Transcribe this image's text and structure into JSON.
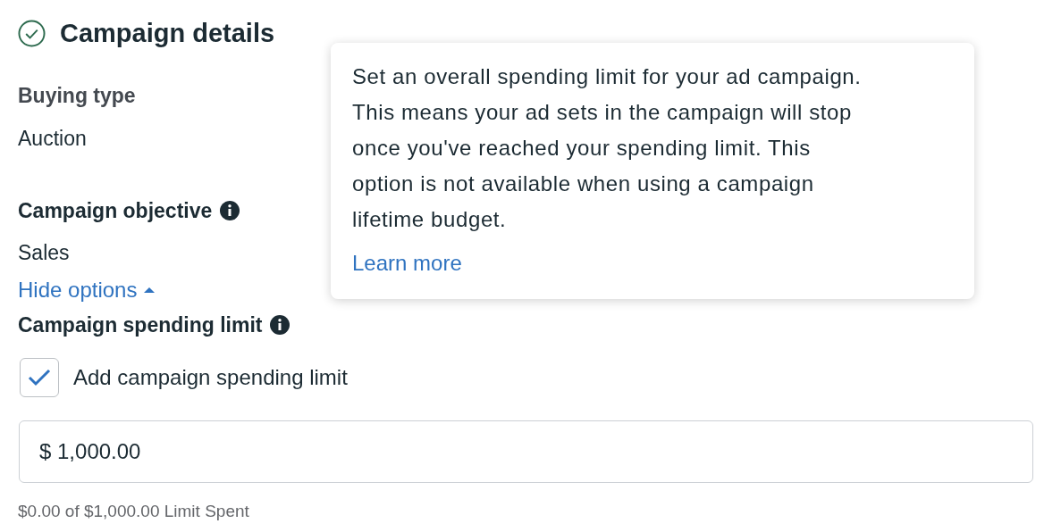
{
  "section": {
    "title": "Campaign details",
    "completed": true
  },
  "fields": [
    {
      "label": "Buying type",
      "info": false,
      "value": "Auction"
    },
    {
      "label": "Campaign objective",
      "info": true,
      "value": "Sales"
    }
  ],
  "toggle_link": {
    "label": "Hide options",
    "expanded": true
  },
  "spending_limit": {
    "label": "Campaign spending limit",
    "info": true,
    "checkbox": {
      "label": "Add campaign spending limit",
      "checked": true
    },
    "amount": "$ 1,000.00",
    "helper": "$0.00 of $1,000.00 Limit Spent"
  },
  "tooltip": {
    "text": "Set an overall spending limit for your ad campaign. This means your ad sets in the campaign will stop once you've reached your spending limit. This option is not available when using a campaign lifetime budget.",
    "link": "Learn more"
  }
}
